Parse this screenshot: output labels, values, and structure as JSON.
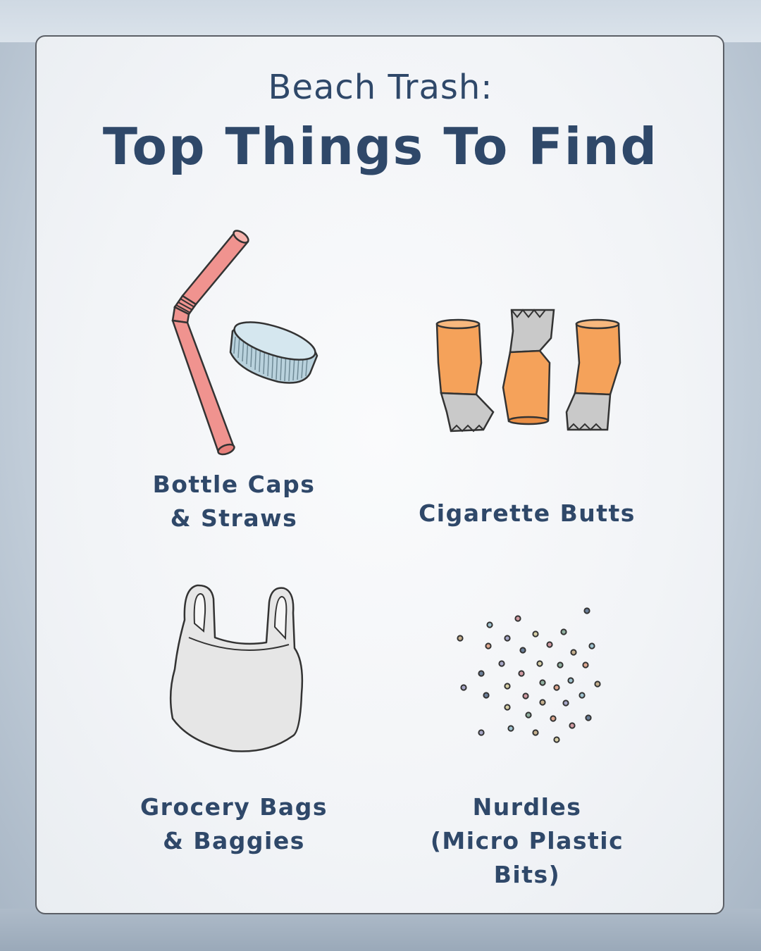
{
  "header": {
    "subtitle": "Beach Trash:",
    "title": "Top Things To Find"
  },
  "items": [
    {
      "line1": "Bottle Caps",
      "line2": "& Straws",
      "icon": "straw-and-bottle-cap-icon"
    },
    {
      "line1": "Cigarette Butts",
      "line2": "",
      "icon": "cigarette-butts-icon"
    },
    {
      "line1": "Grocery Bags",
      "line2": "& Baggies",
      "icon": "plastic-bag-icon"
    },
    {
      "line1": "Nurdles",
      "line2": "(Micro Plastic Bits)",
      "icon": "nurdles-icon"
    }
  ],
  "colors": {
    "text": "#2f4869",
    "straw": "#f0938f",
    "cap": "#b9d2dd",
    "filter": "#f5a25a",
    "ash": "#c9c9c9",
    "bag": "#e6e6e6"
  }
}
